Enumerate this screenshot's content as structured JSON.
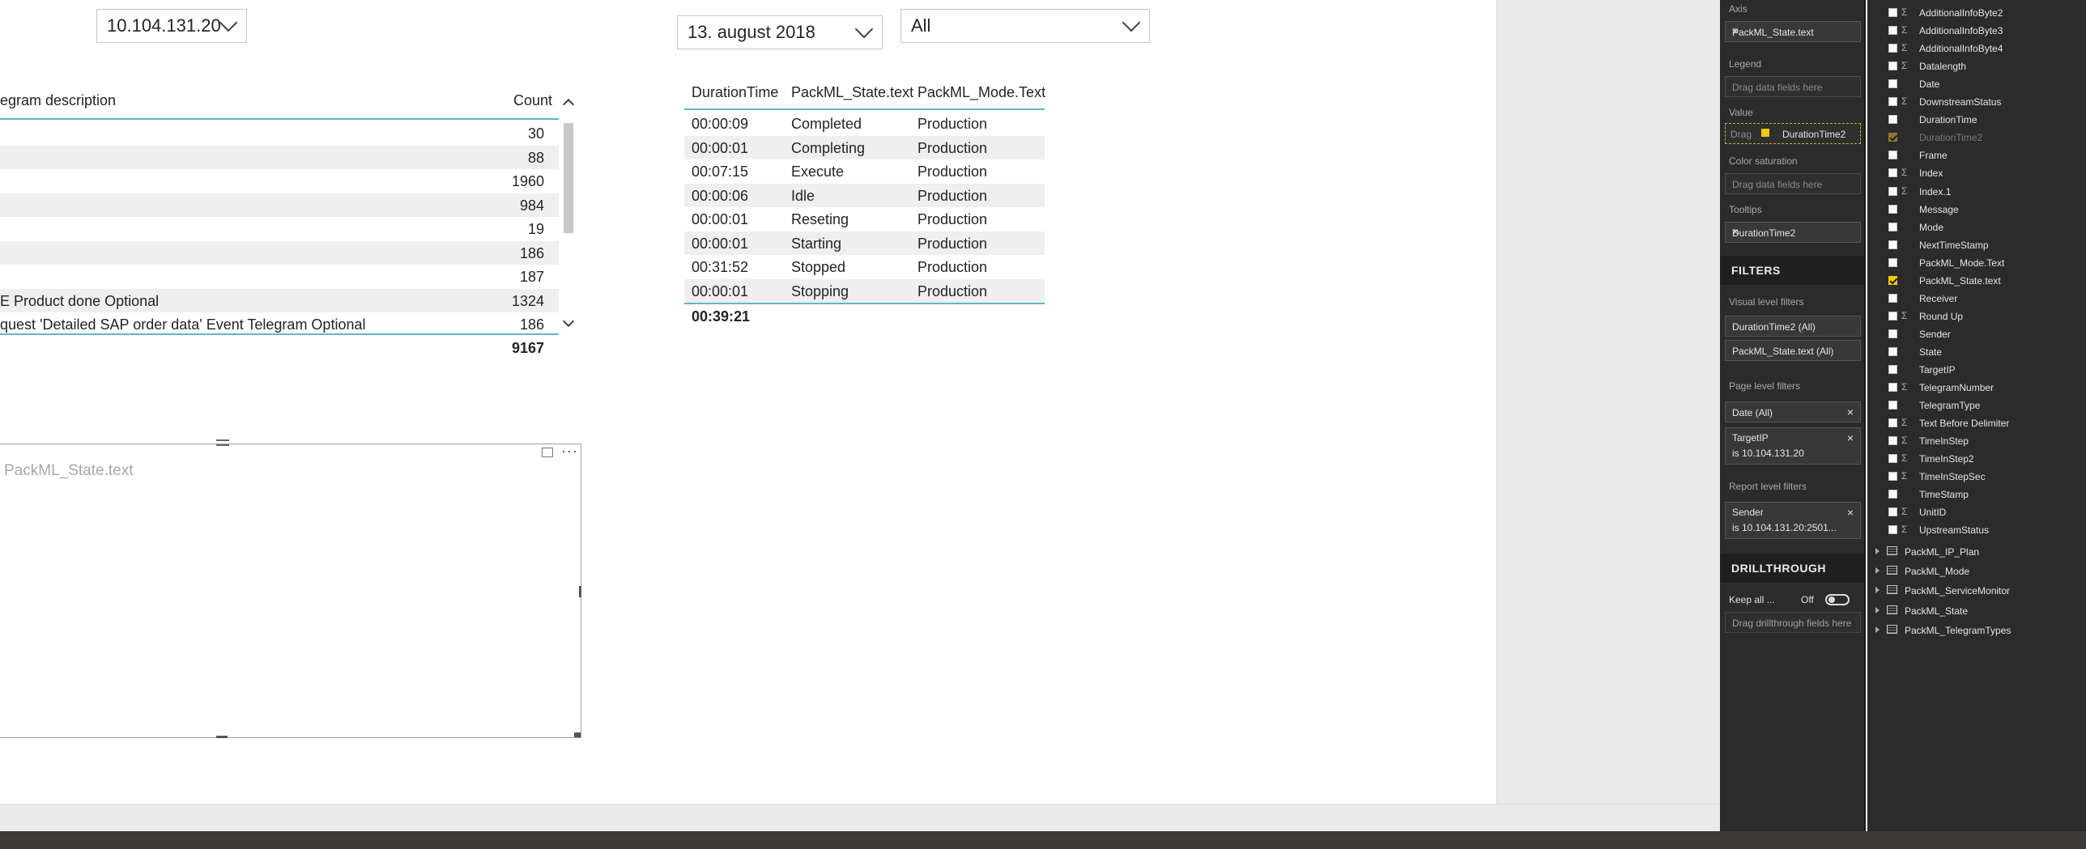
{
  "slicers": {
    "ip": "10.104.131.20",
    "date": "13. august 2018",
    "mode": "All"
  },
  "left_table": {
    "col_description": "egram description",
    "col_count": "Count",
    "rows": [
      {
        "desc": "",
        "count": "30"
      },
      {
        "desc": "",
        "count": "88"
      },
      {
        "desc": "",
        "count": "1960"
      },
      {
        "desc": "",
        "count": "984"
      },
      {
        "desc": "",
        "count": "19"
      },
      {
        "desc": "",
        "count": "186"
      },
      {
        "desc": "",
        "count": "187"
      },
      {
        "desc": "E Product done Optional",
        "count": "1324"
      },
      {
        "desc": "quest 'Detailed SAP order data' Event Telegram Optional",
        "count": "186"
      }
    ],
    "total": "9167"
  },
  "right_table": {
    "headers": [
      "DurationTime",
      "PackML_State.text",
      "PackML_Mode.Text"
    ],
    "rows": [
      [
        "00:00:09",
        "Completed",
        "Production"
      ],
      [
        "00:00:01",
        "Completing",
        "Production"
      ],
      [
        "00:07:15",
        "Execute",
        "Production"
      ],
      [
        "00:00:06",
        "Idle",
        "Production"
      ],
      [
        "00:00:01",
        "Reseting",
        "Production"
      ],
      [
        "00:00:01",
        "Starting",
        "Production"
      ],
      [
        "00:31:52",
        "Stopped",
        "Production"
      ],
      [
        "00:00:01",
        "Stopping",
        "Production"
      ]
    ],
    "total": "00:39:21"
  },
  "empty_visual": {
    "label": "PackML_State.text",
    "more": "···"
  },
  "viz_pane": {
    "axis_label": "Axis",
    "axis_field": "PackML_State.text",
    "legend_label": "Legend",
    "legend_placeholder": "Drag data fields here",
    "value_label": "Value",
    "value_drag_hint": "Drag",
    "value_field": "DurationTime2",
    "color_sat_label": "Color saturation",
    "color_sat_placeholder": "Drag data fields here",
    "tooltips_label": "Tooltips",
    "tooltips_field": "DurationTime2",
    "filters_header": "FILTERS",
    "visual_level_label": "Visual level filters",
    "visual_filters": [
      "DurationTime2 (All)",
      "PackML_State.text (All)"
    ],
    "page_level_label": "Page level filters",
    "page_filter_date": "Date (All)",
    "page_filter_target_name": "TargetIP",
    "page_filter_target_value": "is 10.104.131.20",
    "report_level_label": "Report level filters",
    "report_filter_name": "Sender",
    "report_filter_value": "is 10.104.131.20:2501...",
    "drillthrough_header": "DRILLTHROUGH",
    "keep_all_label": "Keep all ...",
    "keep_all_state": "Off",
    "drill_placeholder": "Drag drillthrough fields here",
    "close_glyph": "×",
    "dropdown_glyph": "▾"
  },
  "fields_pane": {
    "sigma": "Σ",
    "fields": [
      {
        "name": "AdditionalInfoByte2",
        "sigma": true,
        "checked": false
      },
      {
        "name": "AdditionalInfoByte3",
        "sigma": true,
        "checked": false
      },
      {
        "name": "AdditionalInfoByte4",
        "sigma": true,
        "checked": false
      },
      {
        "name": "Datalength",
        "sigma": true,
        "checked": false
      },
      {
        "name": "Date",
        "sigma": false,
        "checked": false
      },
      {
        "name": "DownstreamStatus",
        "sigma": true,
        "checked": false
      },
      {
        "name": "DurationTime",
        "sigma": false,
        "checked": false
      },
      {
        "name": "DurationTime2",
        "sigma": false,
        "checked": true,
        "dim": true
      },
      {
        "name": "Frame",
        "sigma": false,
        "checked": false
      },
      {
        "name": "Index",
        "sigma": true,
        "checked": false
      },
      {
        "name": "Index.1",
        "sigma": true,
        "checked": false
      },
      {
        "name": "Message",
        "sigma": false,
        "checked": false
      },
      {
        "name": "Mode",
        "sigma": false,
        "checked": false
      },
      {
        "name": "NextTimeStamp",
        "sigma": false,
        "checked": false
      },
      {
        "name": "PackML_Mode.Text",
        "sigma": false,
        "checked": false
      },
      {
        "name": "PackML_State.text",
        "sigma": false,
        "checked": true
      },
      {
        "name": "Receiver",
        "sigma": false,
        "checked": false
      },
      {
        "name": "Round Up",
        "sigma": true,
        "checked": false
      },
      {
        "name": "Sender",
        "sigma": false,
        "checked": false
      },
      {
        "name": "State",
        "sigma": false,
        "checked": false
      },
      {
        "name": "TargetIP",
        "sigma": false,
        "checked": false
      },
      {
        "name": "TelegramNumber",
        "sigma": true,
        "checked": false
      },
      {
        "name": "TelegramType",
        "sigma": false,
        "checked": false
      },
      {
        "name": "Text Before Delimiter",
        "sigma": true,
        "checked": false
      },
      {
        "name": "TimeInStep",
        "sigma": true,
        "checked": false
      },
      {
        "name": "TimeInStep2",
        "sigma": true,
        "checked": false
      },
      {
        "name": "TimeInStepSec",
        "sigma": true,
        "checked": false
      },
      {
        "name": "TimeStamp",
        "sigma": false,
        "checked": false
      },
      {
        "name": "UnitID",
        "sigma": true,
        "checked": false
      },
      {
        "name": "UpstreamStatus",
        "sigma": true,
        "checked": false
      }
    ],
    "tables": [
      "PackML_IP_Plan",
      "PackML_Mode",
      "PackML_ServiceMonitor",
      "PackML_State",
      "PackML_TelegramTypes"
    ]
  }
}
